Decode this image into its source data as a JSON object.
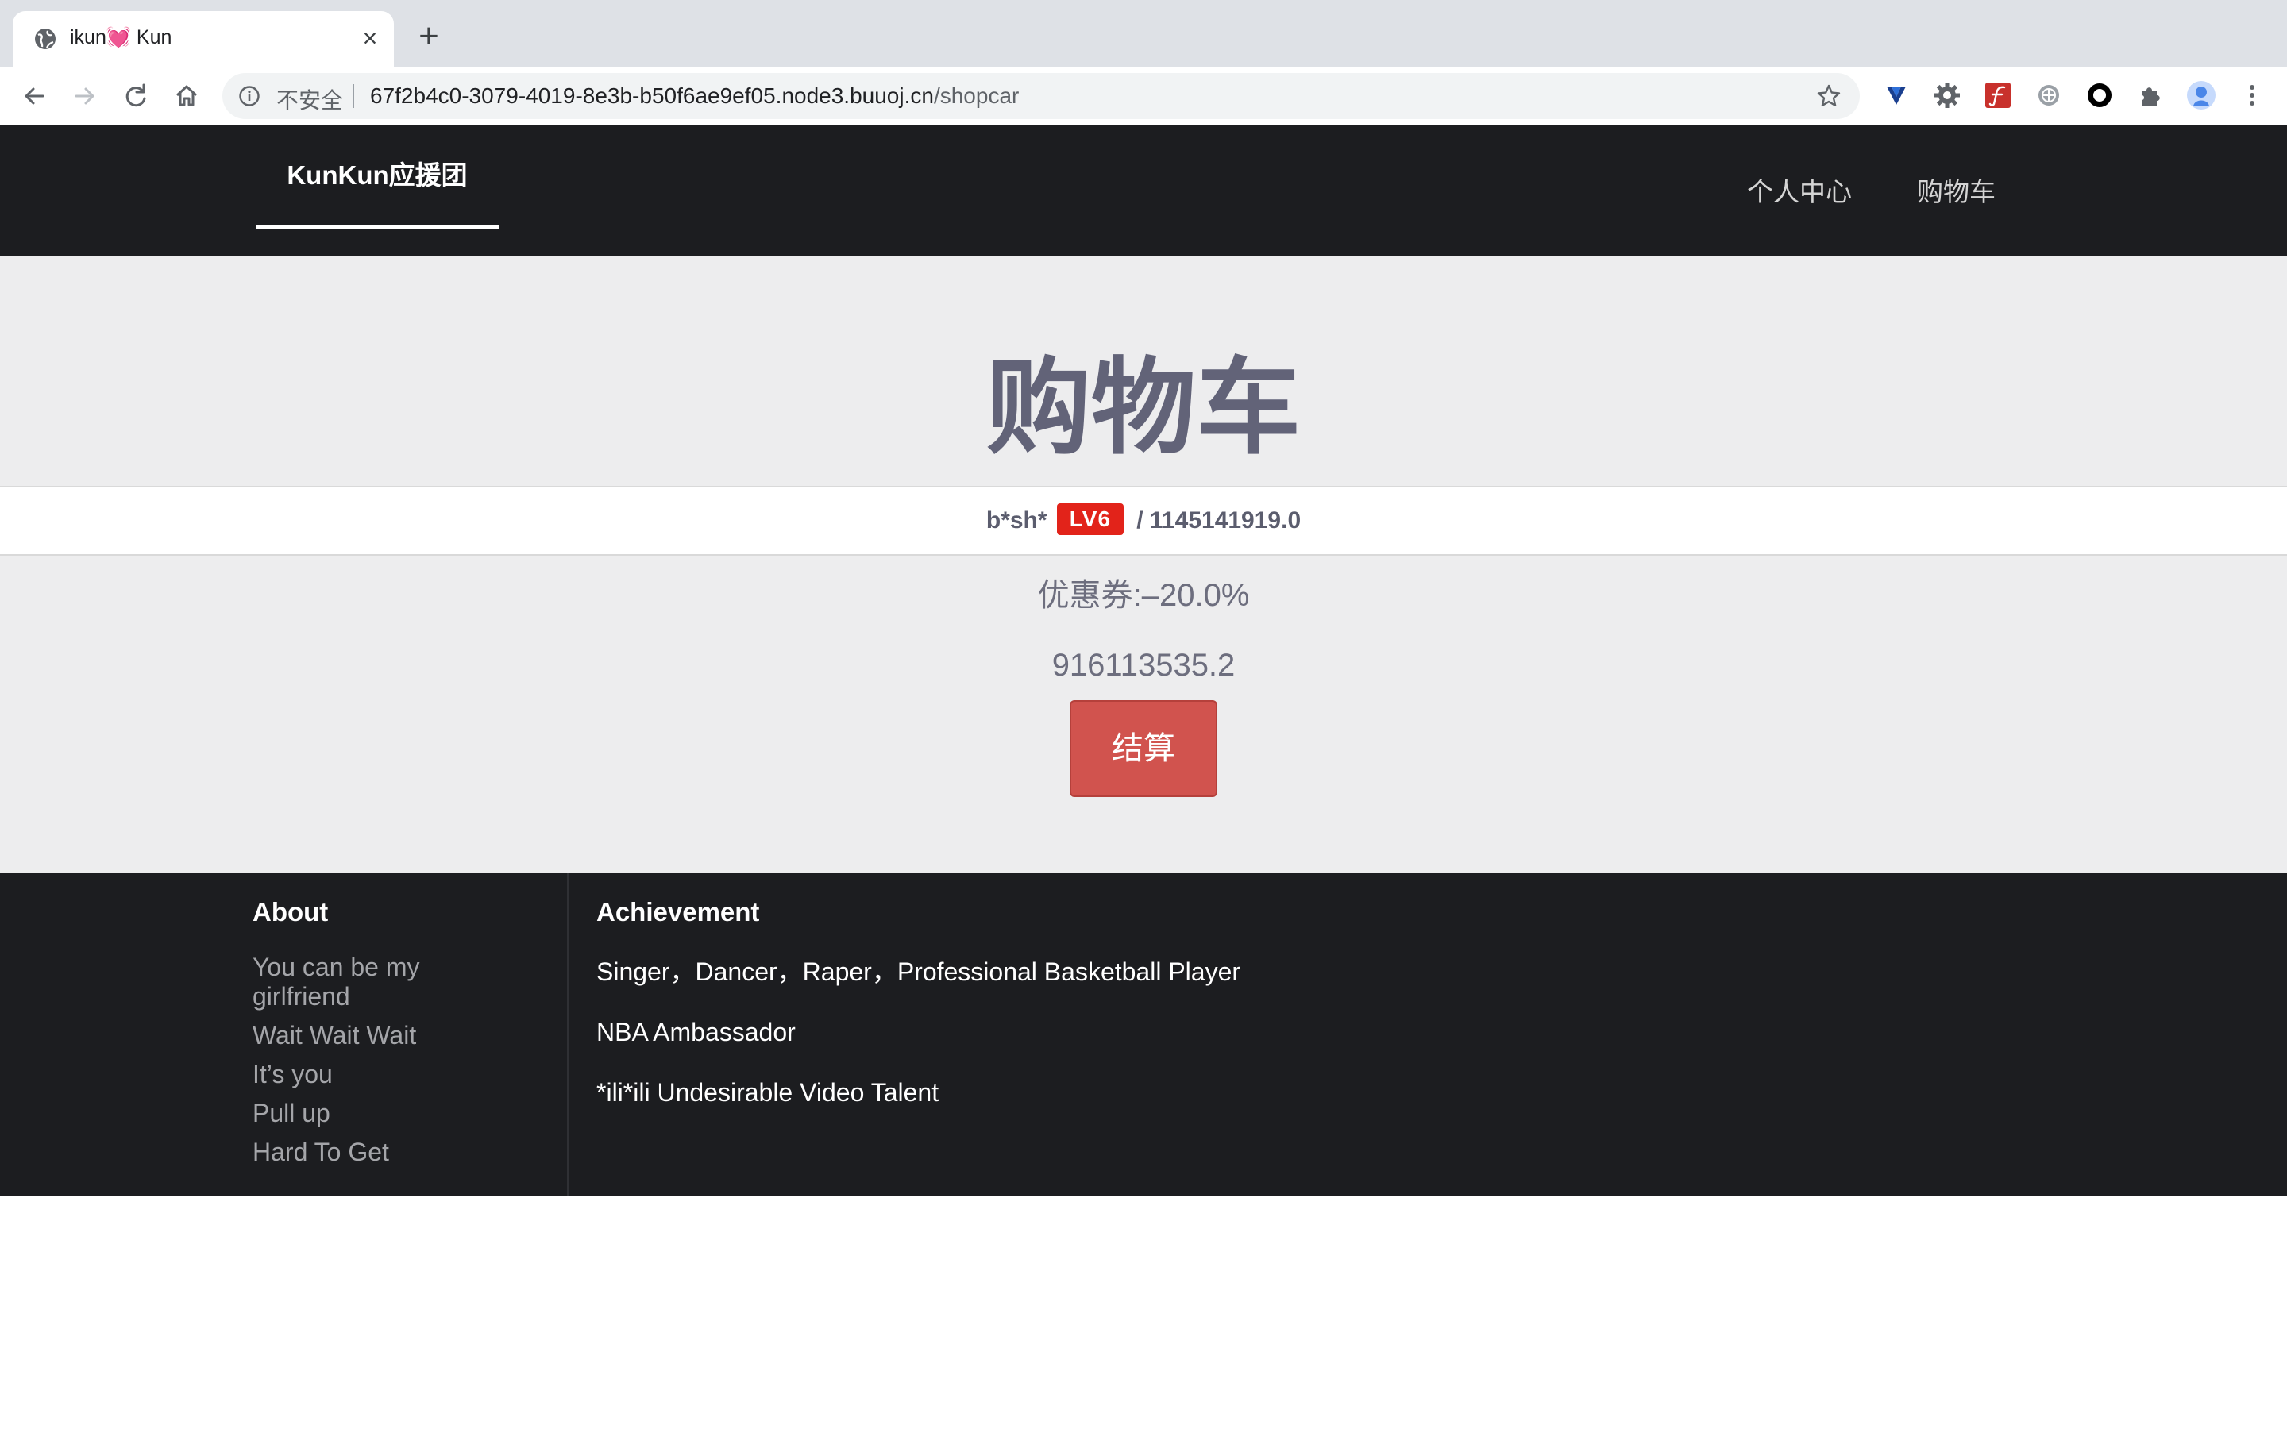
{
  "browser": {
    "tab_title": "ikun💓 Kun",
    "insecure_label": "不安全",
    "url_host": "67f2b4c0-3079-4019-8e3b-b50f6ae9ef05.node3.buuoj.cn",
    "url_path": "/shopcar",
    "icons": [
      "globe-icon",
      "close-icon",
      "plus-icon",
      "back-icon",
      "forward-icon",
      "reload-icon",
      "home-icon",
      "info-icon",
      "star-icon",
      "extension-v-icon",
      "gear-icon",
      "extension-f-icon",
      "extension-grey-icon",
      "extension-ring-icon",
      "puzzle-icon",
      "profile-avatar-icon",
      "more-icon"
    ]
  },
  "nav": {
    "brand": "KunKun应援团",
    "links": [
      "个人中心",
      "购物车"
    ]
  },
  "cart": {
    "title": "购物车",
    "user": "b*sh*",
    "level_badge": "LV6",
    "separator": "/",
    "balance": "1145141919.0",
    "coupon": "优惠券:–20.0%",
    "total": "916113535.2",
    "checkout_label": "结算"
  },
  "footer": {
    "about_title": "About",
    "about_items": [
      "You can be my girlfriend",
      "Wait Wait Wait",
      "It’s you",
      "Pull up",
      "Hard To Get"
    ],
    "achievement_title": "Achievement",
    "achievement_items": [
      "Singer，Dancer，Raper，Professional Basketball Player",
      "NBA Ambassador",
      "*ili*ili Undesirable Video Talent"
    ]
  },
  "colors": {
    "nav_bg": "#1c1d20",
    "page_bg": "#ededee",
    "title_color": "#626378",
    "button_red": "#d1534e",
    "badge_red": "#e2231a"
  }
}
